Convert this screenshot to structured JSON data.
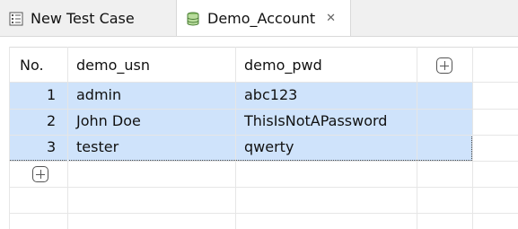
{
  "tabs": [
    {
      "label": "New Test Case"
    },
    {
      "label": "Demo_Account",
      "close_glyph": "✕"
    }
  ],
  "table": {
    "columns": [
      "No.",
      "demo_usn",
      "demo_pwd"
    ],
    "rows": [
      {
        "no": "1",
        "demo_usn": "admin",
        "demo_pwd": "abc123"
      },
      {
        "no": "2",
        "demo_usn": "John Doe",
        "demo_pwd": "ThisIsNotAPassword"
      },
      {
        "no": "3",
        "demo_usn": "tester",
        "demo_pwd": "qwerty"
      }
    ]
  },
  "icons": {
    "test_case": "test-case-icon",
    "data_file": "database-icon",
    "add_column": "add-column-icon",
    "add_row": "add-row-icon"
  },
  "colors": {
    "selection": "#cfe3fb",
    "tabbar_bg": "#f0f0f0"
  }
}
